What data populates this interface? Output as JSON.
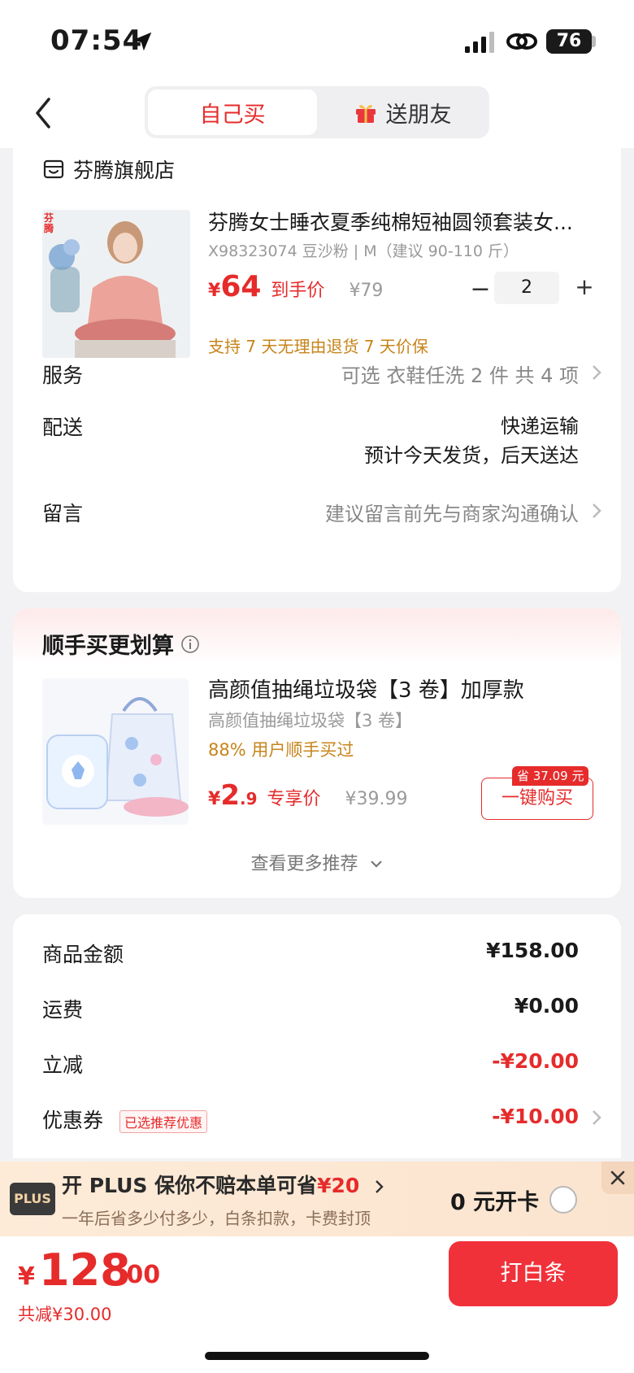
{
  "status_bar": {
    "time": "07:54",
    "battery": "76"
  },
  "nav": {
    "tab_self": "自己买",
    "tab_gift": "送朋友"
  },
  "shop": {
    "name": "芬腾旗舰店"
  },
  "product": {
    "title": "芬腾女士睡衣夏季纯棉短袖圆领套装女...",
    "sku": "X98323074 豆沙粉 | M（建议 90-110 斤）",
    "price_symbol": "¥",
    "price": "64",
    "price_tag": "到手价",
    "original_price": "¥79",
    "quantity": "2",
    "qty_minus": "−",
    "qty_plus": "+",
    "guarantee": "支持 7 天无理由退货   7 天价保",
    "thumb_logo": "芬腾"
  },
  "info_rows": {
    "service_label": "服务",
    "service_value": "可选 衣鞋任洗 2 件 共 4 项",
    "delivery_label": "配送",
    "delivery_line1": "快递运输",
    "delivery_line2": "预计今天发货，后天送达",
    "message_label": "留言",
    "message_value": "建议留言前先与商家沟通确认"
  },
  "recommend": {
    "title": "顺手买更划算",
    "name": "高颜值抽绳垃圾袋【3 卷】加厚款",
    "sub": "高颜值抽绳垃圾袋【3 卷】",
    "stat": "88% 用户顺手买过",
    "price_symbol": "¥",
    "price_int": "2",
    "price_dec": ".9",
    "price_tag": "专享价",
    "original_price": "¥39.99",
    "save_badge": "省 37.09 元",
    "buy_label": "一键购买",
    "more_label": "查看更多推荐"
  },
  "summary": {
    "goods_label": "商品金额",
    "goods_value": "¥158.00",
    "shipping_label": "运费",
    "shipping_value": "¥0.00",
    "discount_label": "立减",
    "discount_value": "-¥20.00",
    "coupon_label": "优惠券",
    "coupon_badge": "已选推荐优惠",
    "coupon_value": "-¥10.00"
  },
  "plus": {
    "logo": "PLUS",
    "title_prefix": "开 PLUS 保你不赔本单可省",
    "title_amount": "¥20",
    "subtitle": "一年后省多少付多少，白条扣款，卡费封顶",
    "open_label": "0 元开卡"
  },
  "bottom": {
    "total_symbol": "¥",
    "total_int": "128",
    "total_dec": ".00",
    "total_saved": "共减¥30.00",
    "pay_label": "打白条"
  },
  "colors": {
    "accent": "#e62b2b",
    "warm": "#c7841a"
  }
}
